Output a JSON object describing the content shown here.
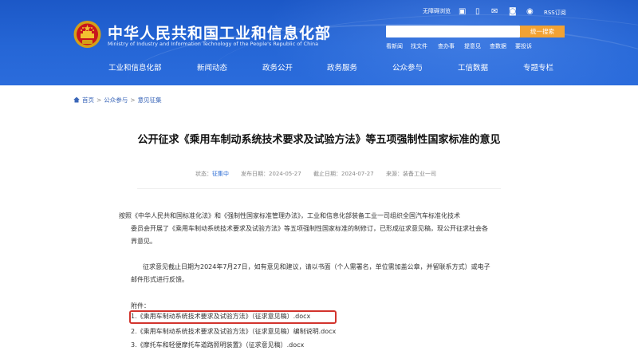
{
  "header": {
    "title": "中华人民共和国工业和信息化部",
    "subtitle": "Ministry of Industry and Information Technology of the People's Republic of China",
    "toplinks": {
      "accessibility": "无障碍浏览",
      "rss": "RSS订阅"
    },
    "search": {
      "value": "",
      "button": "统一搜索"
    },
    "quick_links": [
      "看新闻",
      "找文件",
      "查办事",
      "提意见",
      "查数据",
      "要投诉"
    ]
  },
  "nav": [
    "工业和信息化部",
    "新闻动态",
    "政务公开",
    "政务服务",
    "公众参与",
    "工信数据",
    "专题专栏"
  ],
  "breadcrumb": {
    "items": [
      "首页",
      "公众参与",
      "意见征集"
    ],
    "separator": ">"
  },
  "article": {
    "title": "公开征求《乘用车制动系统技术要求及试验方法》等五项强制性国家标准的意见",
    "meta": {
      "status_label": "状态：",
      "status": "征集中",
      "published_label": "发布日期：",
      "published": "2024-05-27",
      "deadline_label": "截止日期：",
      "deadline": "2024-07-27",
      "source_label": "来源：",
      "source": "装备工业一司"
    },
    "paragraph1_lines": [
      "按照《中华人民共和国标准化法》和《强制性国家标准管理办法》，工业和信息化部装备工业一司组织全国汽车标准化技术",
      "委员会开展了《乘用车制动系统技术要求及试验方法》等五项强制性国家标准的制修订，已形成征求意见稿，现公开征求社会各",
      "界意见。"
    ],
    "paragraph2_lines": [
      "征求意见截止日期为2024年7月27日，如有意见和建议，请以书面（个人需署名，单位需加盖公章，并留联系方式）或电子",
      "邮件形式进行反馈。"
    ],
    "attachments_label": "附件：",
    "attachments": [
      "1.《乘用车制动系统技术要求及试验方法》（征求意见稿）.docx",
      "2.《乘用车制动系统技术要求及试验方法》（征求意见稿）编制说明.docx",
      "3.《摩托车和轻便摩托车道路照明装置》（征求意见稿）.docx"
    ]
  },
  "colors": {
    "header_blue": "#2566d6",
    "search_orange": "#f2a233",
    "highlight_red": "#d2342d",
    "link_blue": "#3a66b8"
  }
}
